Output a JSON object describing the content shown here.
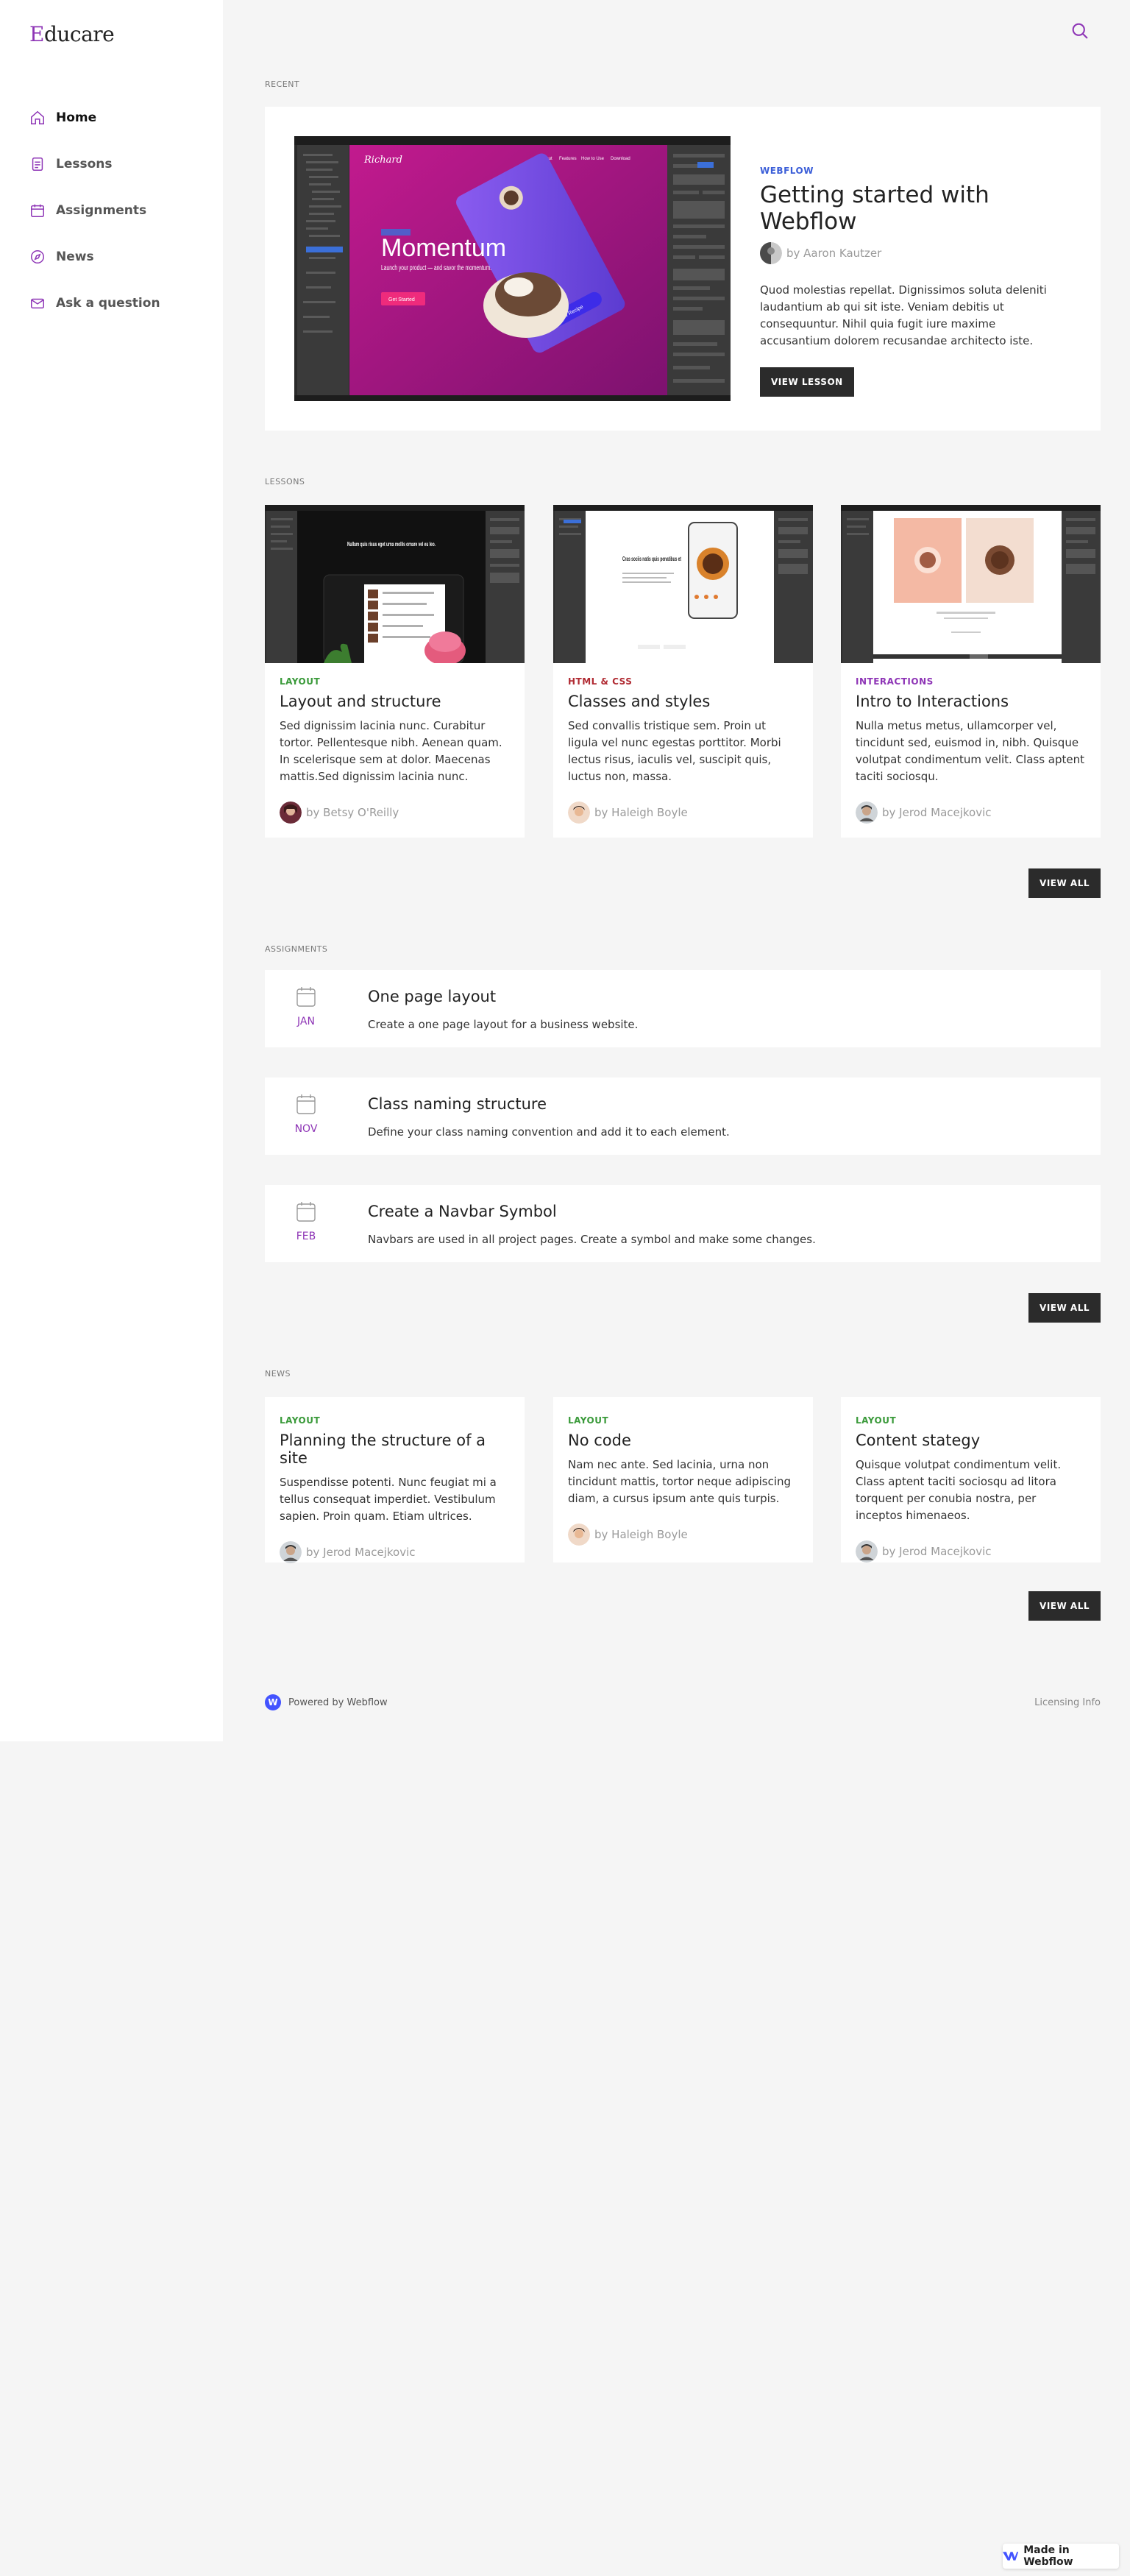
{
  "brand": {
    "first_letter": "E",
    "rest": "ducare"
  },
  "nav": {
    "items": [
      {
        "label": "Home",
        "icon": "home-icon"
      },
      {
        "label": "Lessons",
        "icon": "document-icon"
      },
      {
        "label": "Assignments",
        "icon": "calendar-icon"
      },
      {
        "label": "News",
        "icon": "compass-icon"
      },
      {
        "label": "Ask a question",
        "icon": "mail-icon"
      }
    ]
  },
  "recent": {
    "section_label": "RECENT",
    "tag": "WEBFLOW",
    "title": "Getting started with Webflow",
    "author": "by Aaron Kautzer",
    "description": "Quod molestias repellat. Dignissimos soluta deleniti laudantium ab qui sit iste. Veniam debitis ut consequuntur. Nihil quia fugit iure maxime accusantium dolorem recusandae architecto iste.",
    "button": "VIEW LESSON",
    "preview": {
      "brand": "Richard",
      "nav": [
        "About",
        "Features",
        "How to Use",
        "Download"
      ],
      "headline": "Momentum",
      "sub": "Launch your product — and savor the momentum.",
      "cta": "Get Started",
      "phone_cta": "View Recipe"
    }
  },
  "lessons": {
    "section_label": "LESSONS",
    "items": [
      {
        "tag": "LAYOUT",
        "title": "Layout and structure",
        "description": "Sed dignissim lacinia nunc. Curabitur tortor. Pellentesque nibh. Aenean quam. In scelerisque sem at dolor. Maecenas mattis.Sed dignissim lacinia nunc.",
        "author": "by Betsy O'Reilly",
        "thumb_text": "Nullam quis risus eget urna mollis ornare vel eu leo."
      },
      {
        "tag": "HTML & CSS",
        "title": "Classes and styles",
        "description": "Sed convallis tristique sem. Proin ut ligula vel nunc egestas porttitor. Morbi lectus risus, iaculis vel, suscipit quis, luctus non, massa.",
        "author": "by Haleigh Boyle",
        "thumb_text": "Cras sociis natis quis penatibus et"
      },
      {
        "tag": "INTERACTIONS",
        "title": "Intro to Interactions",
        "description": "Nulla metus metus, ullamcorper vel, tincidunt sed, euismod in, nibh. Quisque volutpat condimentum velit. Class aptent taciti sociosqu.",
        "author": "by Jerod Macejkovic",
        "thumb_text": ""
      }
    ],
    "view_all": "VIEW ALL"
  },
  "assignments": {
    "section_label": "ASSIGNMENTS",
    "items": [
      {
        "month": "JAN",
        "title": "One page layout",
        "description": "Create a one page layout for a business website."
      },
      {
        "month": "NOV",
        "title": "Class naming structure",
        "description": "Define your class naming convention and add it to each element."
      },
      {
        "month": "FEB",
        "title": "Create a Navbar Symbol",
        "description": "Navbars are used in all project pages. Create a symbol and make some changes."
      }
    ],
    "view_all": "VIEW ALL"
  },
  "news": {
    "section_label": "NEWS",
    "items": [
      {
        "tag": "LAYOUT",
        "title": "Planning the structure of a site",
        "description": "Suspendisse potenti. Nunc feugiat mi a tellus consequat imperdiet. Vestibulum sapien. Proin quam. Etiam ultrices.",
        "author": "by Jerod Macejkovic"
      },
      {
        "tag": "LAYOUT",
        "title": "No code",
        "description": "Nam nec ante. Sed lacinia, urna non tincidunt mattis, tortor neque adipiscing diam, a cursus ipsum ante quis turpis.",
        "author": "by Haleigh Boyle"
      },
      {
        "tag": "LAYOUT",
        "title": "Content stategy",
        "description": "Quisque volutpat condimentum velit. Class aptent taciti sociosqu ad litora torquent per conubia nostra, per inceptos himenaeos.",
        "author": "by Jerod Macejkovic"
      }
    ],
    "view_all": "VIEW ALL"
  },
  "footer": {
    "powered": "Powered by Webflow",
    "logo_letter": "W",
    "licensing": "Licensing Info"
  },
  "badge": {
    "label": "Made in Webflow"
  },
  "colors": {
    "accent": "#8e35b6",
    "dark_button": "#2b2b2b",
    "webflow_blue": "#4353ff",
    "tag_blue": "#3b5ed8",
    "tag_green": "#3a9a3a",
    "tag_red": "#b02a32"
  }
}
